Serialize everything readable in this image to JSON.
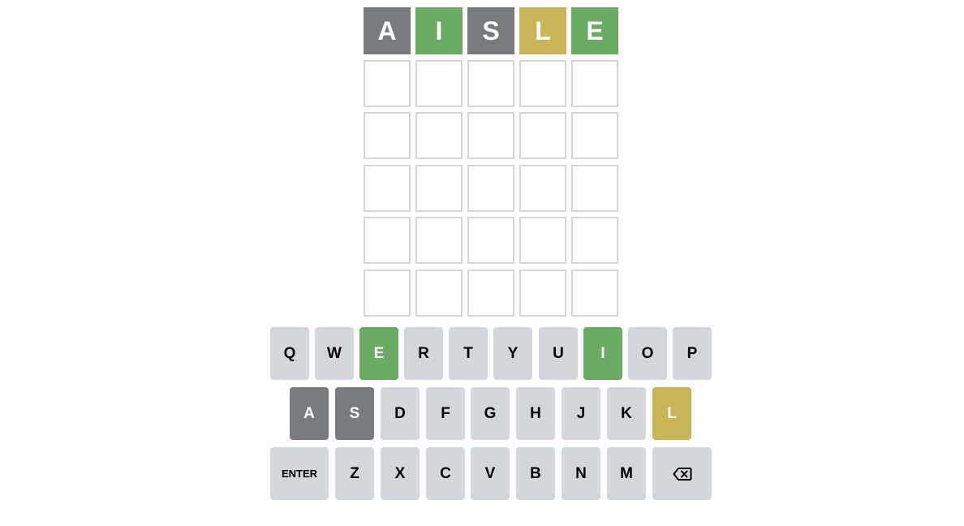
{
  "board": {
    "rows": [
      [
        {
          "letter": "A",
          "state": "absent"
        },
        {
          "letter": "I",
          "state": "correct"
        },
        {
          "letter": "S",
          "state": "absent"
        },
        {
          "letter": "L",
          "state": "present"
        },
        {
          "letter": "E",
          "state": "correct"
        }
      ],
      [
        {
          "letter": "",
          "state": "empty"
        },
        {
          "letter": "",
          "state": "empty"
        },
        {
          "letter": "",
          "state": "empty"
        },
        {
          "letter": "",
          "state": "empty"
        },
        {
          "letter": "",
          "state": "empty"
        }
      ],
      [
        {
          "letter": "",
          "state": "empty"
        },
        {
          "letter": "",
          "state": "empty"
        },
        {
          "letter": "",
          "state": "empty"
        },
        {
          "letter": "",
          "state": "empty"
        },
        {
          "letter": "",
          "state": "empty"
        }
      ],
      [
        {
          "letter": "",
          "state": "empty"
        },
        {
          "letter": "",
          "state": "empty"
        },
        {
          "letter": "",
          "state": "empty"
        },
        {
          "letter": "",
          "state": "empty"
        },
        {
          "letter": "",
          "state": "empty"
        }
      ],
      [
        {
          "letter": "",
          "state": "empty"
        },
        {
          "letter": "",
          "state": "empty"
        },
        {
          "letter": "",
          "state": "empty"
        },
        {
          "letter": "",
          "state": "empty"
        },
        {
          "letter": "",
          "state": "empty"
        }
      ],
      [
        {
          "letter": "",
          "state": "empty"
        },
        {
          "letter": "",
          "state": "empty"
        },
        {
          "letter": "",
          "state": "empty"
        },
        {
          "letter": "",
          "state": "empty"
        },
        {
          "letter": "",
          "state": "empty"
        }
      ]
    ]
  },
  "keyboard": {
    "rows": [
      [
        {
          "label": "Q",
          "state": "unused"
        },
        {
          "label": "W",
          "state": "unused"
        },
        {
          "label": "E",
          "state": "correct"
        },
        {
          "label": "R",
          "state": "unused"
        },
        {
          "label": "T",
          "state": "unused"
        },
        {
          "label": "Y",
          "state": "unused"
        },
        {
          "label": "U",
          "state": "unused"
        },
        {
          "label": "I",
          "state": "correct"
        },
        {
          "label": "O",
          "state": "unused"
        },
        {
          "label": "P",
          "state": "unused"
        }
      ],
      [
        {
          "label": "A",
          "state": "absent"
        },
        {
          "label": "S",
          "state": "absent"
        },
        {
          "label": "D",
          "state": "unused"
        },
        {
          "label": "F",
          "state": "unused"
        },
        {
          "label": "G",
          "state": "unused"
        },
        {
          "label": "H",
          "state": "unused"
        },
        {
          "label": "J",
          "state": "unused"
        },
        {
          "label": "K",
          "state": "unused"
        },
        {
          "label": "L",
          "state": "present"
        }
      ],
      [
        {
          "label": "ENTER",
          "state": "unused",
          "kind": "enter"
        },
        {
          "label": "Z",
          "state": "unused"
        },
        {
          "label": "X",
          "state": "unused"
        },
        {
          "label": "C",
          "state": "unused"
        },
        {
          "label": "V",
          "state": "unused"
        },
        {
          "label": "B",
          "state": "unused"
        },
        {
          "label": "N",
          "state": "unused"
        },
        {
          "label": "M",
          "state": "unused"
        },
        {
          "label": "",
          "state": "unused",
          "kind": "backspace",
          "icon": "backspace-icon"
        }
      ]
    ]
  },
  "colors": {
    "correct": "#6aaa64",
    "present": "#c9b458",
    "absent": "#787c7e",
    "key_unused": "#d3d6da",
    "tile_border": "#d3d6da"
  }
}
